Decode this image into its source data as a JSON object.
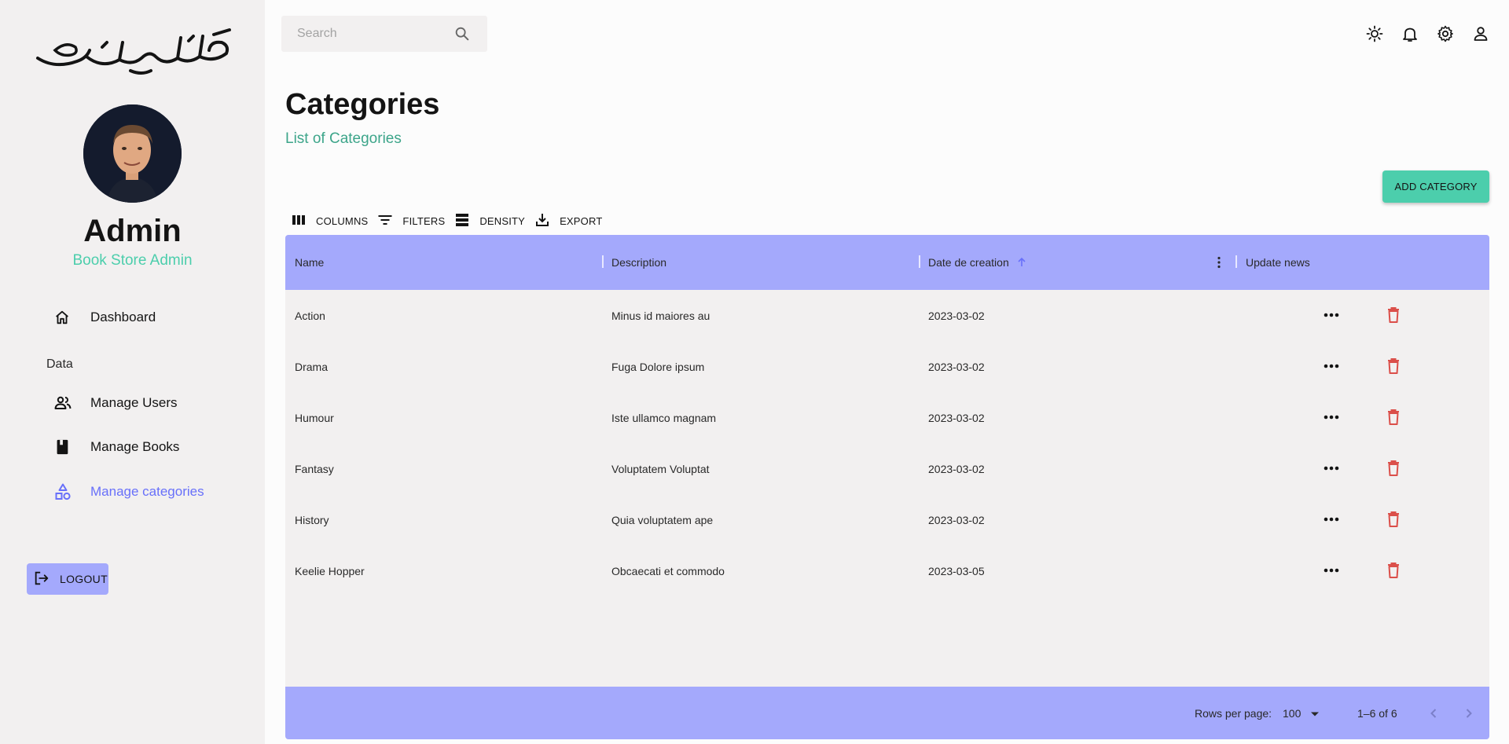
{
  "brand": {
    "logo_text": "كتابي صطور"
  },
  "profile": {
    "name": "Admin",
    "role": "Book Store Admin"
  },
  "sidebar": {
    "dashboard_label": "Dashboard",
    "section_label": "Data",
    "items": [
      {
        "label": "Manage Users",
        "icon": "people-icon"
      },
      {
        "label": "Manage Books",
        "icon": "book-icon"
      },
      {
        "label": "Manage categories",
        "icon": "category-icon",
        "active": true
      }
    ],
    "logout_label": "LOGOUT"
  },
  "topbar": {
    "search_placeholder": "Search",
    "icons": [
      "light-mode-icon",
      "notifications-icon",
      "settings-icon",
      "person-icon"
    ]
  },
  "header": {
    "title": "Categories",
    "subtitle": "List of Categories"
  },
  "add_button_label": "ADD CATEGORY",
  "toolbar": {
    "columns": "COLUMNS",
    "filters": "FILTERS",
    "density": "DENSITY",
    "export": "EXPORT"
  },
  "grid": {
    "columns": [
      "Name",
      "Description",
      "Date de creation",
      "Update news"
    ],
    "rows": [
      {
        "name": "Action",
        "description": "Minus id maiores au",
        "date": "2023-03-02"
      },
      {
        "name": "Drama",
        "description": "Fuga Dolore ipsum",
        "date": "2023-03-02"
      },
      {
        "name": "Humour",
        "description": "Iste ullamco magnam",
        "date": "2023-03-02"
      },
      {
        "name": "Fantasy",
        "description": "Voluptatem Voluptat",
        "date": "2023-03-02"
      },
      {
        "name": "History",
        "description": "Quia voluptatem ape",
        "date": "2023-03-02"
      },
      {
        "name": "Keelie Hopper",
        "description": "Obcaecati et commodo",
        "date": "2023-03-05"
      }
    ],
    "footer": {
      "rows_per_page_label": "Rows per page:",
      "rows_per_page_value": "100",
      "range": "1–6 of 6"
    }
  },
  "colors": {
    "accent_green": "#4cceac",
    "accent_blue": "#a4a9fc",
    "active_nav": "#6870fa",
    "delete_red": "#db4f4a"
  }
}
